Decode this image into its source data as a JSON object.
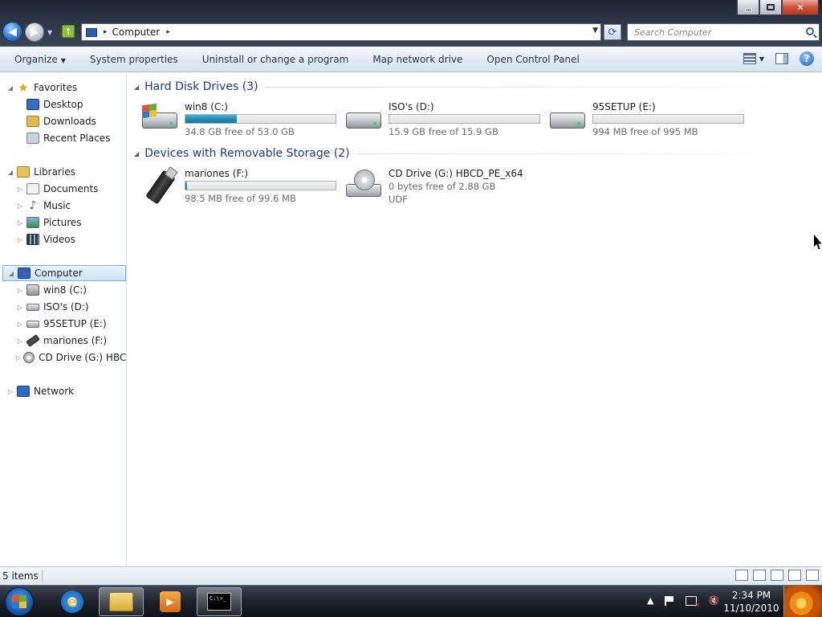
{
  "window": {
    "buttons": {
      "minimize": "—",
      "maximize": "□",
      "close": "✕"
    }
  },
  "nav": {
    "back_icon": "back-arrow-icon",
    "forward_icon": "forward-arrow-icon"
  },
  "address": {
    "path": "Computer",
    "separator": "▸"
  },
  "search": {
    "placeholder": "Search Computer"
  },
  "toolbar": {
    "organize": "Organize",
    "system_properties": "System properties",
    "uninstall": "Uninstall or change a program",
    "map_drive": "Map network drive",
    "control_panel": "Open Control Panel",
    "help": "?"
  },
  "sidebar": {
    "favorites": {
      "label": "Favorites",
      "items": [
        "Desktop",
        "Downloads",
        "Recent Places"
      ]
    },
    "libraries": {
      "label": "Libraries",
      "items": [
        "Documents",
        "Music",
        "Pictures",
        "Videos"
      ]
    },
    "computer": {
      "label": "Computer",
      "items": [
        "win8 (C:)",
        "ISO's (D:)",
        "95SETUP (E:)",
        "mariones (F:)",
        "CD Drive (G:) HBCD_"
      ]
    },
    "network": {
      "label": "Network"
    }
  },
  "content": {
    "hdd_group": "Hard Disk Drives (3)",
    "removable_group": "Devices with Removable Storage (2)",
    "drives": [
      {
        "name": "win8 (C:)",
        "free": "34.8 GB free of 53.0 GB",
        "used_fraction": 0.343
      },
      {
        "name": "ISO's (D:)",
        "free": "15.9 GB free of 15.9 GB",
        "used_fraction": 0.0
      },
      {
        "name": "95SETUP (E:)",
        "free": "994 MB free of 995 MB",
        "used_fraction": 0.001
      },
      {
        "name": "mariones (F:)",
        "free": "98.5 MB free of 99.6 MB",
        "used_fraction": 0.011
      },
      {
        "name": "CD Drive (G:) HBCD_PE_x64",
        "free": "0 bytes free of 2.88 GB",
        "filesystem": "UDF"
      }
    ]
  },
  "status": {
    "items": "5 items"
  },
  "taskbar": {
    "clock_time": "2:34 PM",
    "clock_date": "11/10/2010",
    "cmd_text": "C:\\>_"
  },
  "colors": {
    "accent": "#1e3a8a",
    "bar_fill": "#1f8db6"
  }
}
